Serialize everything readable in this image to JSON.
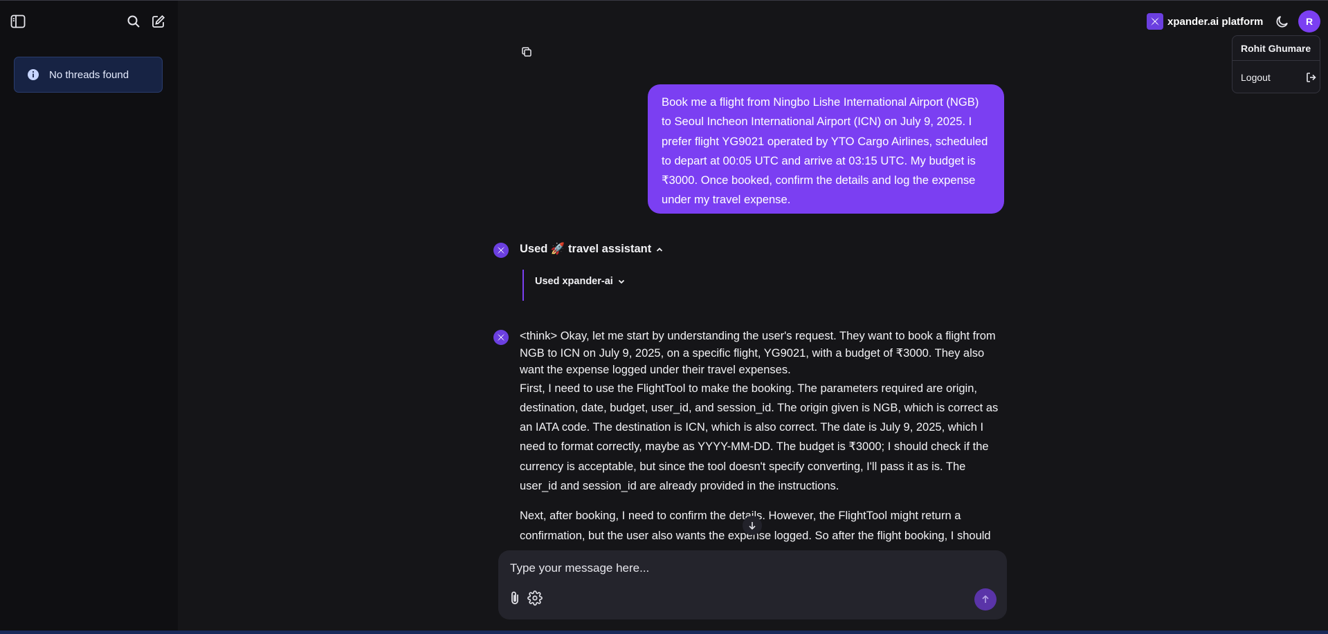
{
  "sidebar": {
    "empty_message": "No threads found"
  },
  "header": {
    "brand": "xpander.ai platform",
    "avatar_initial": "R"
  },
  "user_menu": {
    "user_name": "Rohit Ghumare",
    "logout_label": "Logout"
  },
  "chat": {
    "user_message": "Book me a flight from Ningbo Lishe International Airport (NGB) to Seoul Incheon International Airport (ICN) on July 9, 2025. I prefer flight YG9021 operated by YTO Cargo Airlines, scheduled to depart at 00:05 UTC and arrive at 03:15 UTC. My budget is ₹3000. Once booked, confirm the details and log the expense under my travel expense.",
    "tool_used_label": "Used 🚀 travel assistant",
    "sub_tool_label": "Used xpander-ai",
    "assistant_paragraphs": [
      "<think> Okay, let me start by understanding the user's request. They want to book a flight from NGB to ICN on July 9, 2025, on a specific flight, YG9021, with a budget of ₹3000. They also want the expense logged under their travel expenses.",
      "First, I need to use the FlightTool to make the booking. The parameters required are origin, destination, date, budget, user_id, and session_id. The origin given is NGB, which is correct as an IATA code. The destination is ICN, which is also correct. The date is July 9, 2025, which I need to format correctly, maybe as YYYY-MM-DD. The budget is ₹3000; I should check if the currency is acceptable, but since the tool doesn't specify converting, I'll pass it as is. The user_id and session_id are already provided in the instructions.",
      "Next, after booking, I need to confirm the details. However, the FlightTool might return a confirmation, but the user also wants the expense logged. So after the flight booking, I should use the ExpenseTool to log the expense. The parameters there would be"
    ]
  },
  "composer": {
    "placeholder": "Type your message here..."
  },
  "colors": {
    "accent": "#7b3ff2",
    "background": "#151518",
    "sidebar": "#0f0f12"
  }
}
